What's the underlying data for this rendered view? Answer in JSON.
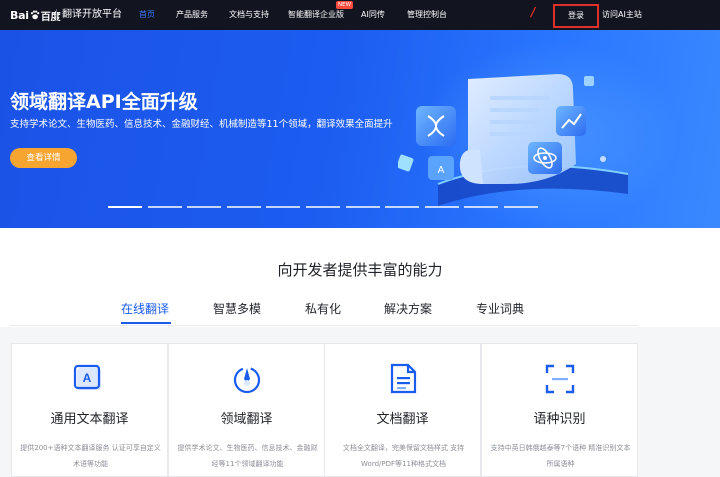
{
  "header": {
    "logo_bai": "Bai",
    "logo_cn": "百度",
    "site_name": "翻译开放平台",
    "nav": [
      {
        "label": "首页",
        "active": true
      },
      {
        "label": "产品服务",
        "active": false
      },
      {
        "label": "文档与支持",
        "active": false
      },
      {
        "label": "智能翻译企业版",
        "active": false
      },
      {
        "label": "AI同传",
        "active": false
      },
      {
        "label": "管理控制台",
        "active": false
      }
    ],
    "new_badge": "NEW",
    "annotation_mark": "/",
    "login_label": "登录",
    "visit_ai_label": "访问AI主站"
  },
  "banner": {
    "title": "领域翻译API全面升级",
    "subtitle": "支持学术论文、生物医药、信息技术、金融财经、机械制造等11个领域，翻译效果全面提升",
    "button_label": "查看详情",
    "indicator_count": 11,
    "active_indicator": 0
  },
  "capabilities": {
    "title": "向开发者提供丰富的能力",
    "tabs": [
      {
        "label": "在线翻译",
        "active": true
      },
      {
        "label": "智慧多模",
        "active": false
      },
      {
        "label": "私有化",
        "active": false
      },
      {
        "label": "解决方案",
        "active": false
      },
      {
        "label": "专业词典",
        "active": false
      }
    ],
    "cards": [
      {
        "icon": "text-translate-icon",
        "title": "通用文本翻译",
        "desc": "提供200+语种文本翻译服务 认证可享自定义术语等功能"
      },
      {
        "icon": "domain-translate-icon",
        "title": "领域翻译",
        "desc": "提供学术论文、生物医药、信息技术、金融财经等11个领域翻译功能"
      },
      {
        "icon": "document-translate-icon",
        "title": "文档翻译",
        "desc": "文档全文翻译，完美保留文档样式 支持Word/PDF等11种格式文档"
      },
      {
        "icon": "language-detect-icon",
        "title": "语种识别",
        "desc": "支持中英日韩俄越泰等7个语种 精准识别文本所属语种"
      }
    ]
  },
  "colors": {
    "nav_bg": "#121420",
    "nav_active": "#3d7bfa",
    "banner_blue": "#1c5cf0",
    "button_orange": "#f7a531",
    "tab_active": "#1a5ced",
    "annotation_red": "#e0302b"
  }
}
